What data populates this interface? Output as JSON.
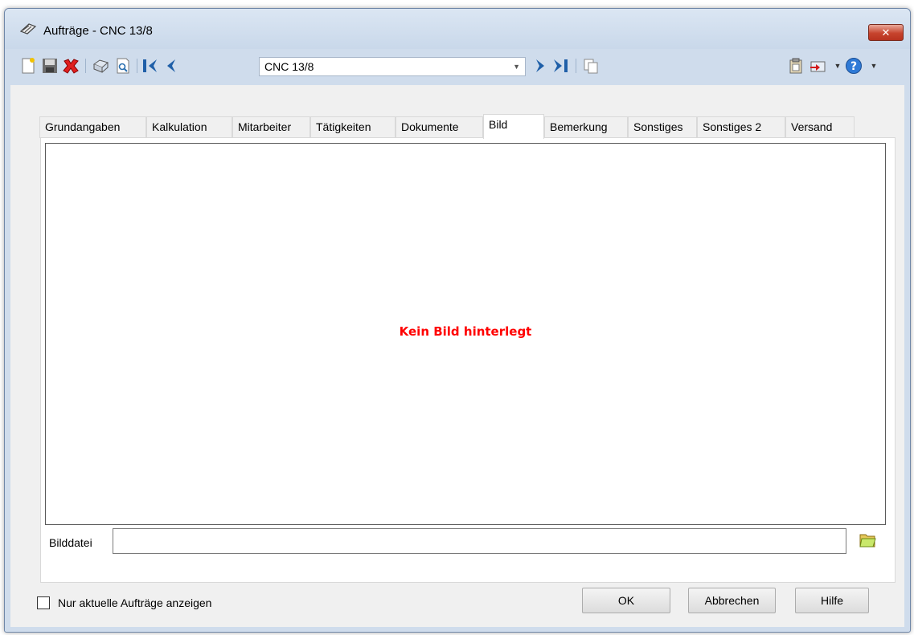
{
  "window": {
    "title": "Aufträge - CNC 13/8",
    "close_label": "✕"
  },
  "toolbar": {
    "record_value": "CNC 13/8",
    "icons": [
      "new-icon",
      "save-icon",
      "delete-icon",
      "print-icon",
      "preview-icon",
      "first-record-icon",
      "previous-record-icon",
      "next-record-icon",
      "last-record-icon",
      "copy-icon",
      "clipboard-icon",
      "export-icon",
      "help-icon"
    ]
  },
  "tabs": [
    {
      "label": "Grundangaben"
    },
    {
      "label": "Kalkulation"
    },
    {
      "label": "Mitarbeiter"
    },
    {
      "label": "Tätigkeiten"
    },
    {
      "label": "Dokumente"
    },
    {
      "label": "Bild",
      "active": true
    },
    {
      "label": "Bemerkung"
    },
    {
      "label": "Sonstiges"
    },
    {
      "label": "Sonstiges 2"
    },
    {
      "label": "Versand"
    }
  ],
  "picture": {
    "empty_message": "Kein Bild hinterlegt",
    "file_label": "Bilddatei",
    "file_value": ""
  },
  "footer": {
    "checkbox_label": "Nur aktuelle Aufträge anzeigen",
    "checkbox_checked": false,
    "ok_label": "OK",
    "cancel_label": "Abbrechen",
    "help_label": "Hilfe"
  },
  "colors": {
    "empty_message": "#ff0000",
    "close_button": "#c7432d"
  }
}
